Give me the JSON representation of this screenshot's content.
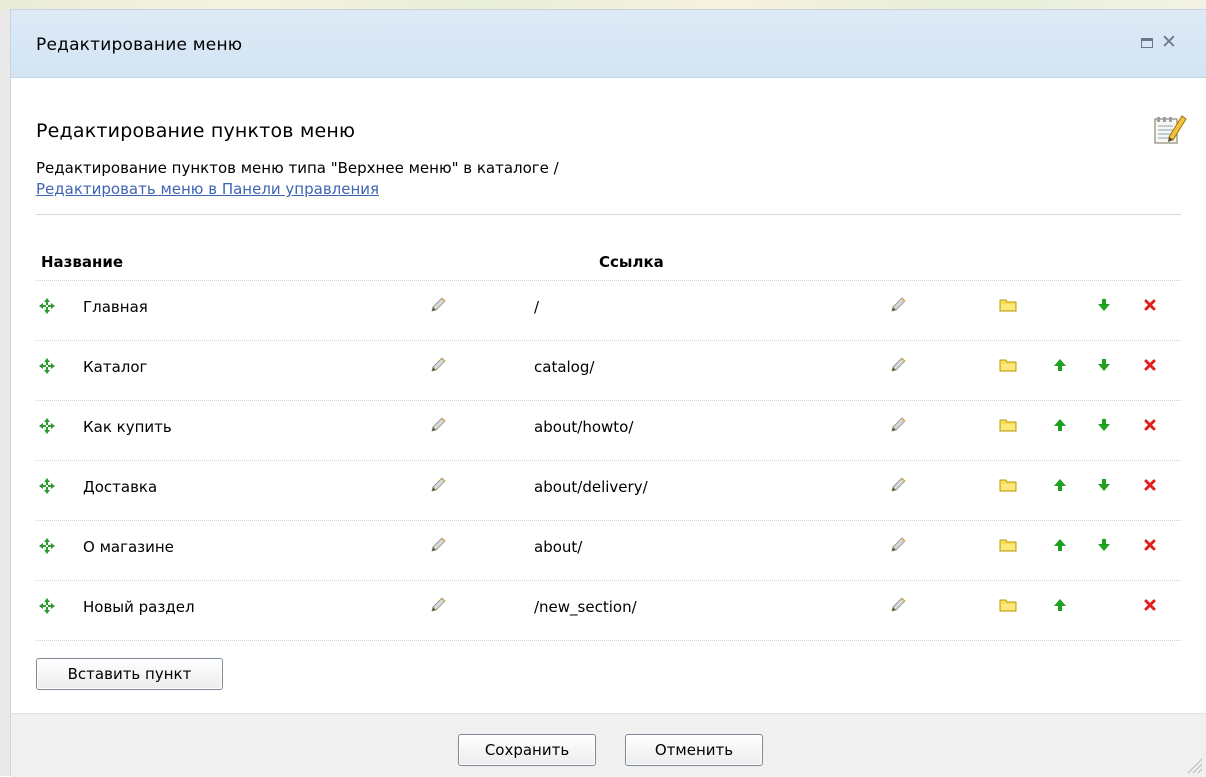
{
  "dialog": {
    "title": "Редактирование меню"
  },
  "section": {
    "title": "Редактирование пунктов меню",
    "description": "Редактирование пунктов меню типа \"Верхнее меню\" в каталоге /",
    "link_text": "Редактировать меню в Панели управления"
  },
  "table": {
    "col_name": "Название",
    "col_link": "Ссылка",
    "rows": [
      {
        "name": "Главная",
        "link": "/",
        "can_up": false,
        "can_down": true
      },
      {
        "name": "Каталог",
        "link": "catalog/",
        "can_up": true,
        "can_down": true
      },
      {
        "name": "Как купить",
        "link": "about/howto/",
        "can_up": true,
        "can_down": true
      },
      {
        "name": "Доставка",
        "link": "about/delivery/",
        "can_up": true,
        "can_down": true
      },
      {
        "name": "О магазине",
        "link": "about/",
        "can_up": true,
        "can_down": true
      },
      {
        "name": "Новый раздел",
        "link": "/new_section/",
        "can_up": true,
        "can_down": false
      }
    ]
  },
  "buttons": {
    "insert_label": "Вставить пункт",
    "save_label": "Сохранить",
    "cancel_label": "Отменить"
  },
  "icons": {
    "drag": "move-arrows-icon",
    "edit": "pencil-icon",
    "folder": "folder-icon",
    "up": "arrow-up-icon",
    "down": "arrow-down-icon",
    "delete": "delete-x-icon",
    "notepad": "notepad-edit-icon",
    "maximize": "maximize-icon",
    "close": "close-icon"
  },
  "colors": {
    "titlebar": "#d6e6f4",
    "link": "#3f65b2",
    "arrow_green": "#1ea11e",
    "delete_red": "#e0201c",
    "folder_yellow": "#f5d94a"
  }
}
